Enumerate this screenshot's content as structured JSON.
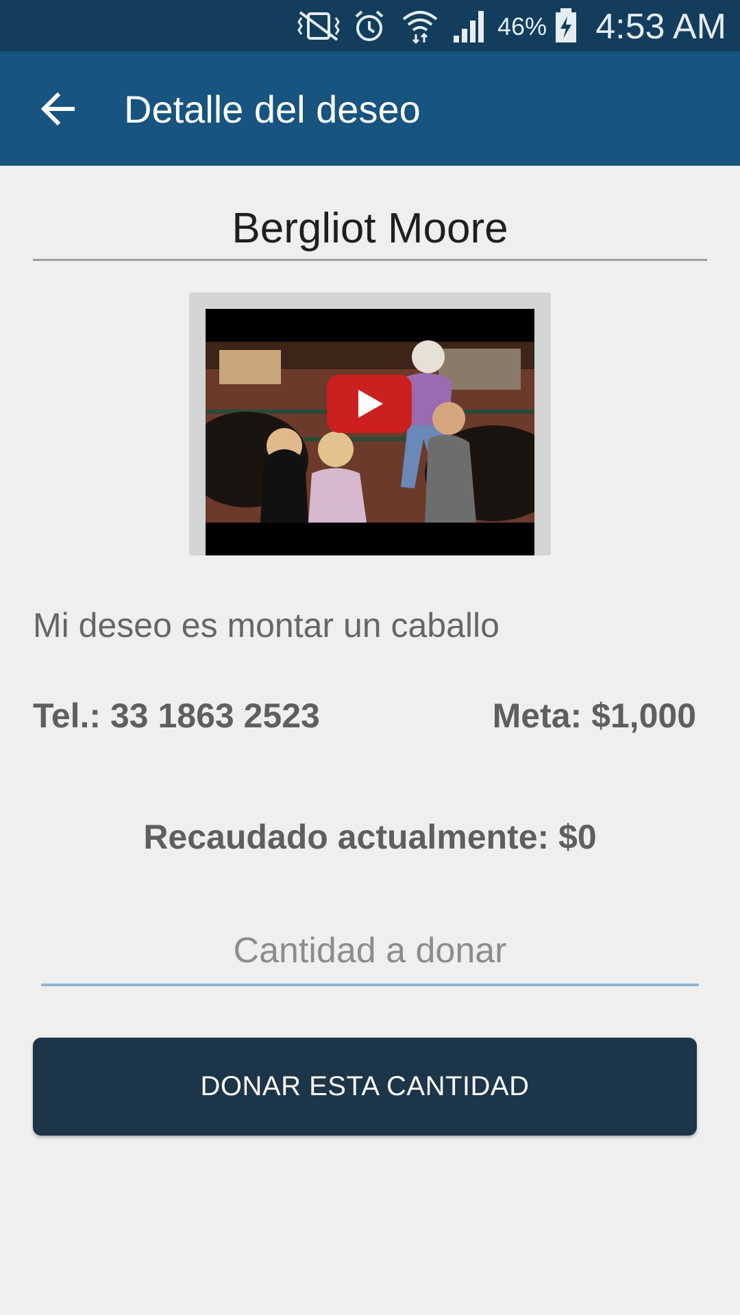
{
  "status_bar": {
    "battery_percent": "46%",
    "time": "4:53 AM",
    "icons": [
      "vibrate-mute-icon",
      "alarm-icon",
      "wifi-icon",
      "signal-icon",
      "battery-charging-icon"
    ]
  },
  "app_bar": {
    "back_icon": "arrow-left-icon",
    "title": "Detalle del deseo"
  },
  "wish": {
    "name": "Bergliot Moore",
    "video_thumbnail": "video-thumbnail",
    "description": "Mi deseo es montar un caballo",
    "phone": "Tel.: 33 1863 2523",
    "goal": "Meta: $1,000",
    "raised": "Recaudado actualmente: $0"
  },
  "donation": {
    "amount_value": "",
    "amount_placeholder": "Cantidad a donar",
    "button_label": "DONAR ESTA CANTIDAD"
  },
  "colors": {
    "status_bar": "#133d5d",
    "app_bar": "#17547f",
    "background": "#efefef",
    "button": "#1d3549",
    "input_underline": "#8cb6d8",
    "play_button": "#cc1f1f"
  }
}
